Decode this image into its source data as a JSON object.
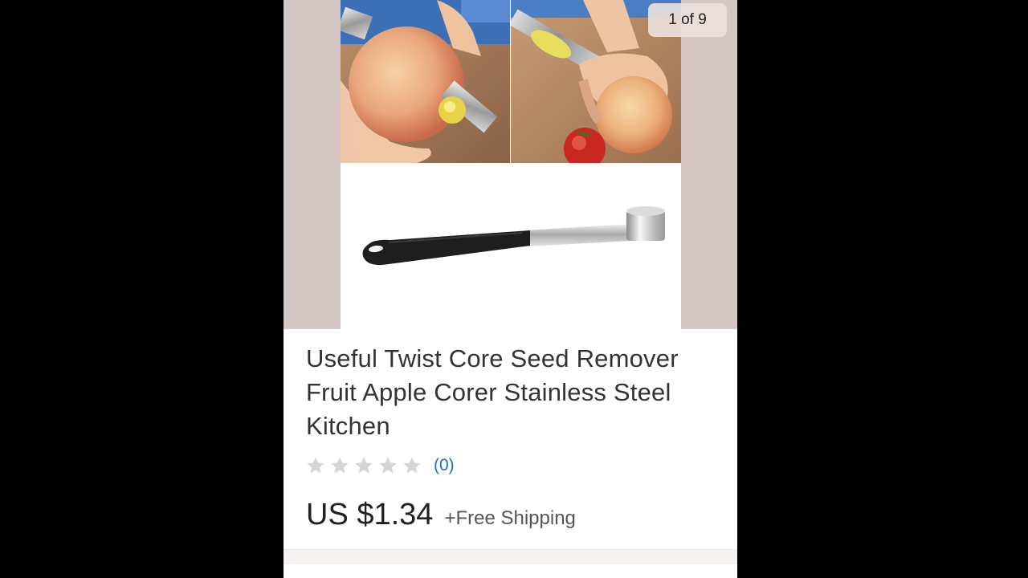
{
  "gallery": {
    "counter_text": "1 of 9",
    "current_index": 1,
    "total_images": 9,
    "images": [
      {
        "subject": "apple-corer-in-use-photo"
      },
      {
        "subject": "apple-corer-tool-photo"
      }
    ]
  },
  "product": {
    "title": "Useful Twist Core Seed Remover Fruit Apple Corer Stainless Steel Kitchen",
    "rating": {
      "stars_filled": 0,
      "stars_total": 5,
      "review_count_text": "(0)"
    },
    "price": "US $1.34",
    "shipping": "+Free Shipping"
  },
  "colors": {
    "background": "#000000",
    "gallery_backdrop": "#d4c7c5",
    "link": "#1f6fbf",
    "star_empty": "#d5d5d5"
  }
}
